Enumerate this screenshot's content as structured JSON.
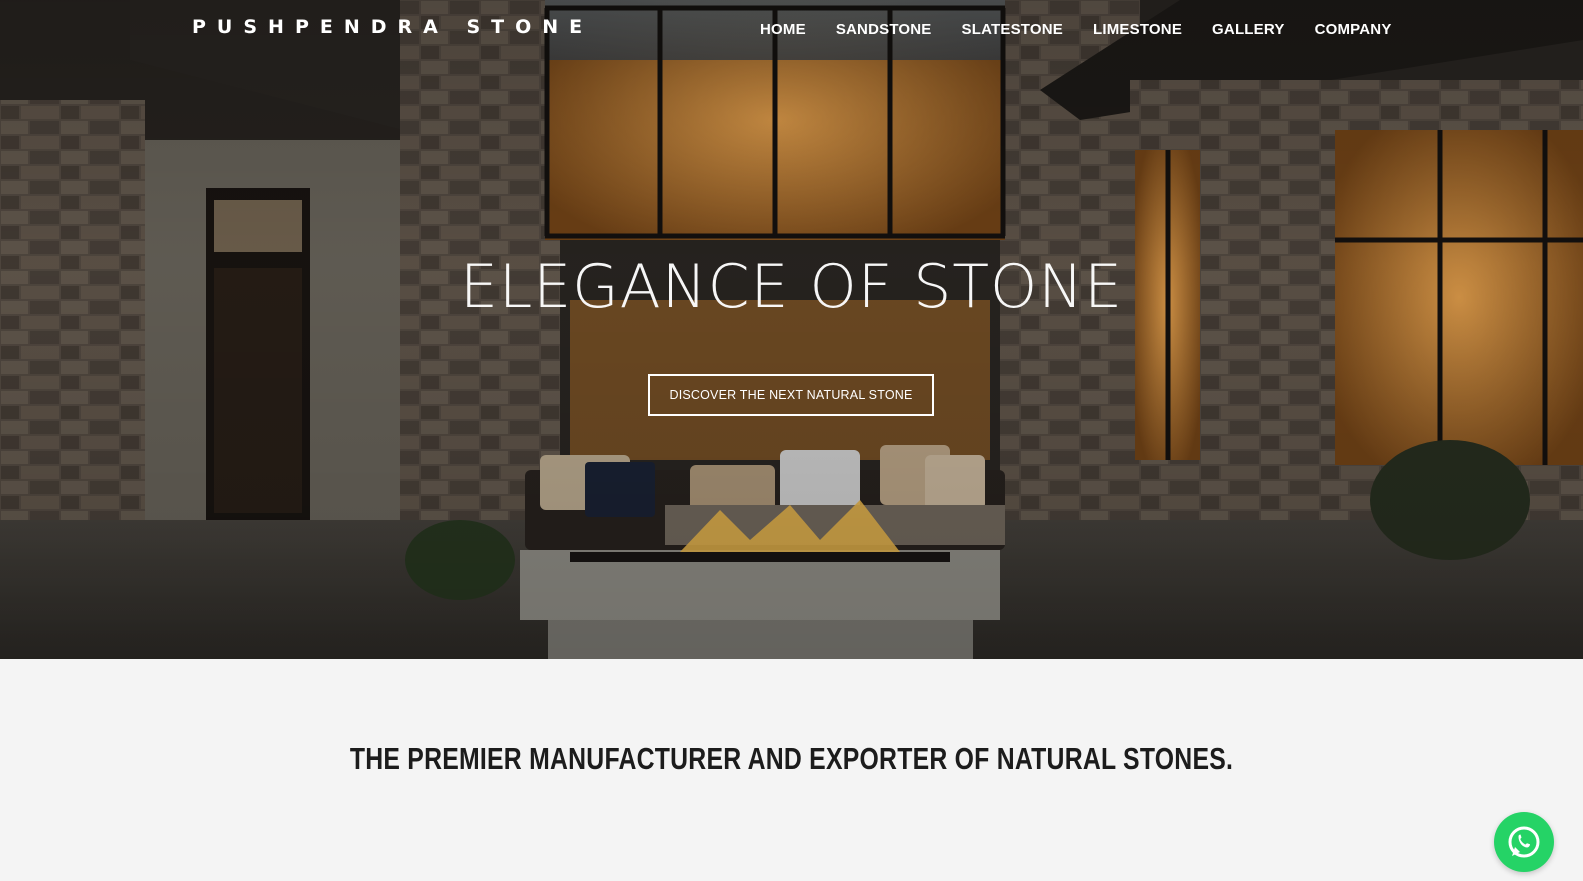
{
  "brand": {
    "logo_text": "PUSHPENDRA STONE"
  },
  "nav": {
    "items": [
      {
        "label": "HOME"
      },
      {
        "label": "SANDSTONE"
      },
      {
        "label": "SLATESTONE"
      },
      {
        "label": "LIMESTONE"
      },
      {
        "label": "GALLERY"
      },
      {
        "label": "COMPANY"
      }
    ]
  },
  "hero": {
    "title": "ELEGANCE OF STONE",
    "cta_label": "DISCOVER THE NEXT NATURAL STONE"
  },
  "main": {
    "tagline": "THE PREMIER MANUFACTURER AND EXPORTER OF NATURAL STONES."
  },
  "icons": {
    "chat": "whatsapp-icon"
  },
  "colors": {
    "whatsapp": "#25d366",
    "hero_text": "#ffffff",
    "tagline": "#1c1c1c",
    "page_bg": "#f4f4f4"
  }
}
